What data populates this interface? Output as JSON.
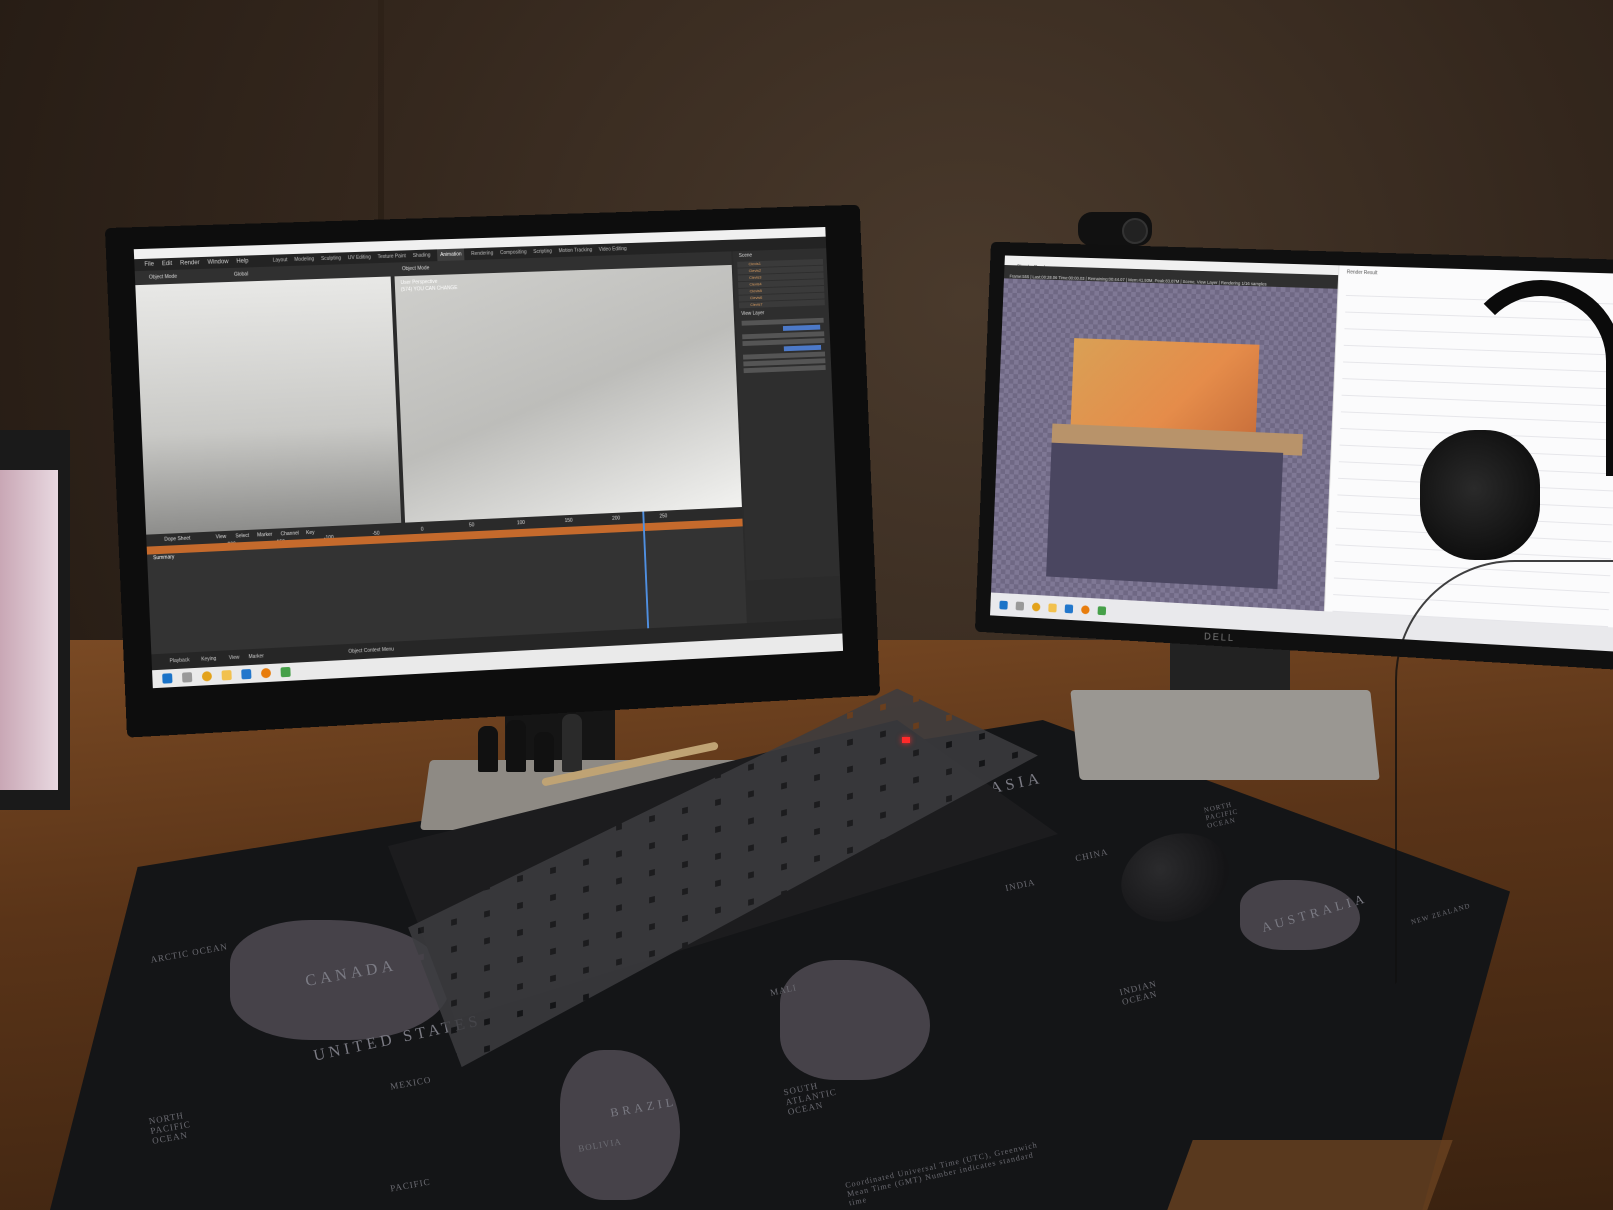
{
  "blender": {
    "menu": [
      "File",
      "Edit",
      "Render",
      "Window",
      "Help"
    ],
    "workspace_tabs": [
      "Layout",
      "Modeling",
      "Sculpting",
      "UV Editing",
      "Texture Paint",
      "Shading",
      "Animation",
      "Rendering",
      "Compositing",
      "Scripting",
      "Motion Tracking",
      "Video Editing"
    ],
    "active_tab": "Animation",
    "mode_left": "Object Mode",
    "mode_right": "Object Mode",
    "orientation": "Global",
    "view_label": "User Perspective",
    "view_sub": "(574) YOU CAN CHANGE",
    "outliner": [
      "Clevis1",
      "Clevis2",
      "Clevis3",
      "Clevis4",
      "Clevis5",
      "Clevis6",
      "Clevis7"
    ],
    "scene_label": "Scene",
    "view_layer_label": "View Layer",
    "timeline_menu": [
      "Dope Sheet",
      "View",
      "Select",
      "Marker",
      "Channel",
      "Key"
    ],
    "summary_label": "Summary",
    "playback_menu": [
      "Playback",
      "Keying",
      "View",
      "Marker"
    ],
    "frame_numbers": [
      "-200",
      "-150",
      "-100",
      "-50",
      "0",
      "50",
      "100",
      "150",
      "200",
      "250"
    ],
    "status_text": "Object Context Menu"
  },
  "render_window": {
    "title": "Blender Render",
    "header": "Render Result",
    "info": "Frame:555 | Last:00:28.06 Time:00:00.03 | Remaining:00:44.07 | Mem:41.93M, Peak:83.87M | Scene, View Layer | Rendering 1/16 samples"
  },
  "mousepad": {
    "labels": [
      "CANADA",
      "UNITED STATES",
      "MEXICO",
      "BRAZIL",
      "BOLIVIA",
      "INDIA",
      "MALI",
      "AUSTRALIA",
      "NEW ZEALAND",
      "ASIA",
      "CHINA"
    ],
    "oceans": [
      "ARCTIC OCEAN",
      "NORTH PACIFIC OCEAN",
      "SOUTH ATLANTIC OCEAN",
      "INDIAN OCEAN",
      "NORTH PACIFIC OCEAN",
      "PACIFIC"
    ],
    "legend": "Coordinated Universal Time (UTC), Greenwich Mean Time (GMT) Number indicates standard time"
  },
  "brand": "DELL",
  "colors": {
    "blender_dark": "#2b2b2b",
    "timeline_accent": "#c56a2c",
    "playhead": "#4f8fe0",
    "render_warm": "#e58c4a",
    "led": "#ff2a2a"
  }
}
